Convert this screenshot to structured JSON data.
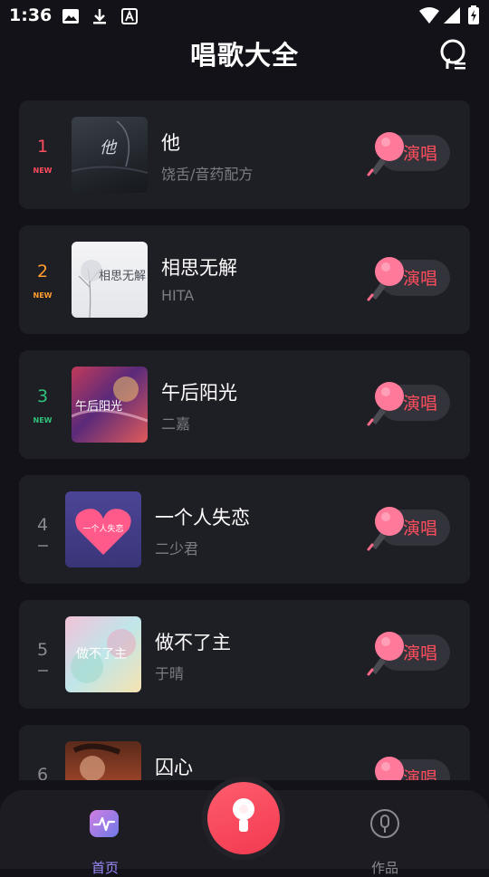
{
  "status_bar": {
    "time": "1:36"
  },
  "header": {
    "title": "唱歌大全"
  },
  "sing_label": "演唱",
  "songs": [
    {
      "rank": "1",
      "badge": "NEW",
      "rank_color": "#ff4d5e",
      "title": "他",
      "artist": "饶舌/音药配方"
    },
    {
      "rank": "2",
      "badge": "NEW",
      "rank_color": "#ff9d2e",
      "title": "相思无解",
      "artist": "HITA"
    },
    {
      "rank": "3",
      "badge": "NEW",
      "rank_color": "#2fc27a",
      "title": "午后阳光",
      "artist": "二嘉"
    },
    {
      "rank": "4",
      "badge": "",
      "rank_color": "#8a8a90",
      "title": "一个人失恋",
      "artist": "二少君"
    },
    {
      "rank": "5",
      "badge": "",
      "rank_color": "#8a8a90",
      "title": "做不了主",
      "artist": "于晴"
    },
    {
      "rank": "6",
      "badge": "",
      "rank_color": "#8a8a90",
      "title": "囚心",
      "artist": ""
    }
  ],
  "covers": [
    {
      "text": "他"
    },
    {
      "text": "相思无解"
    },
    {
      "text": "午后阳光"
    },
    {
      "text": "一个人失恋"
    },
    {
      "text": "做不了主"
    },
    {
      "text": ""
    }
  ],
  "tabbar": {
    "home_label": "首页",
    "works_label": "作品"
  }
}
